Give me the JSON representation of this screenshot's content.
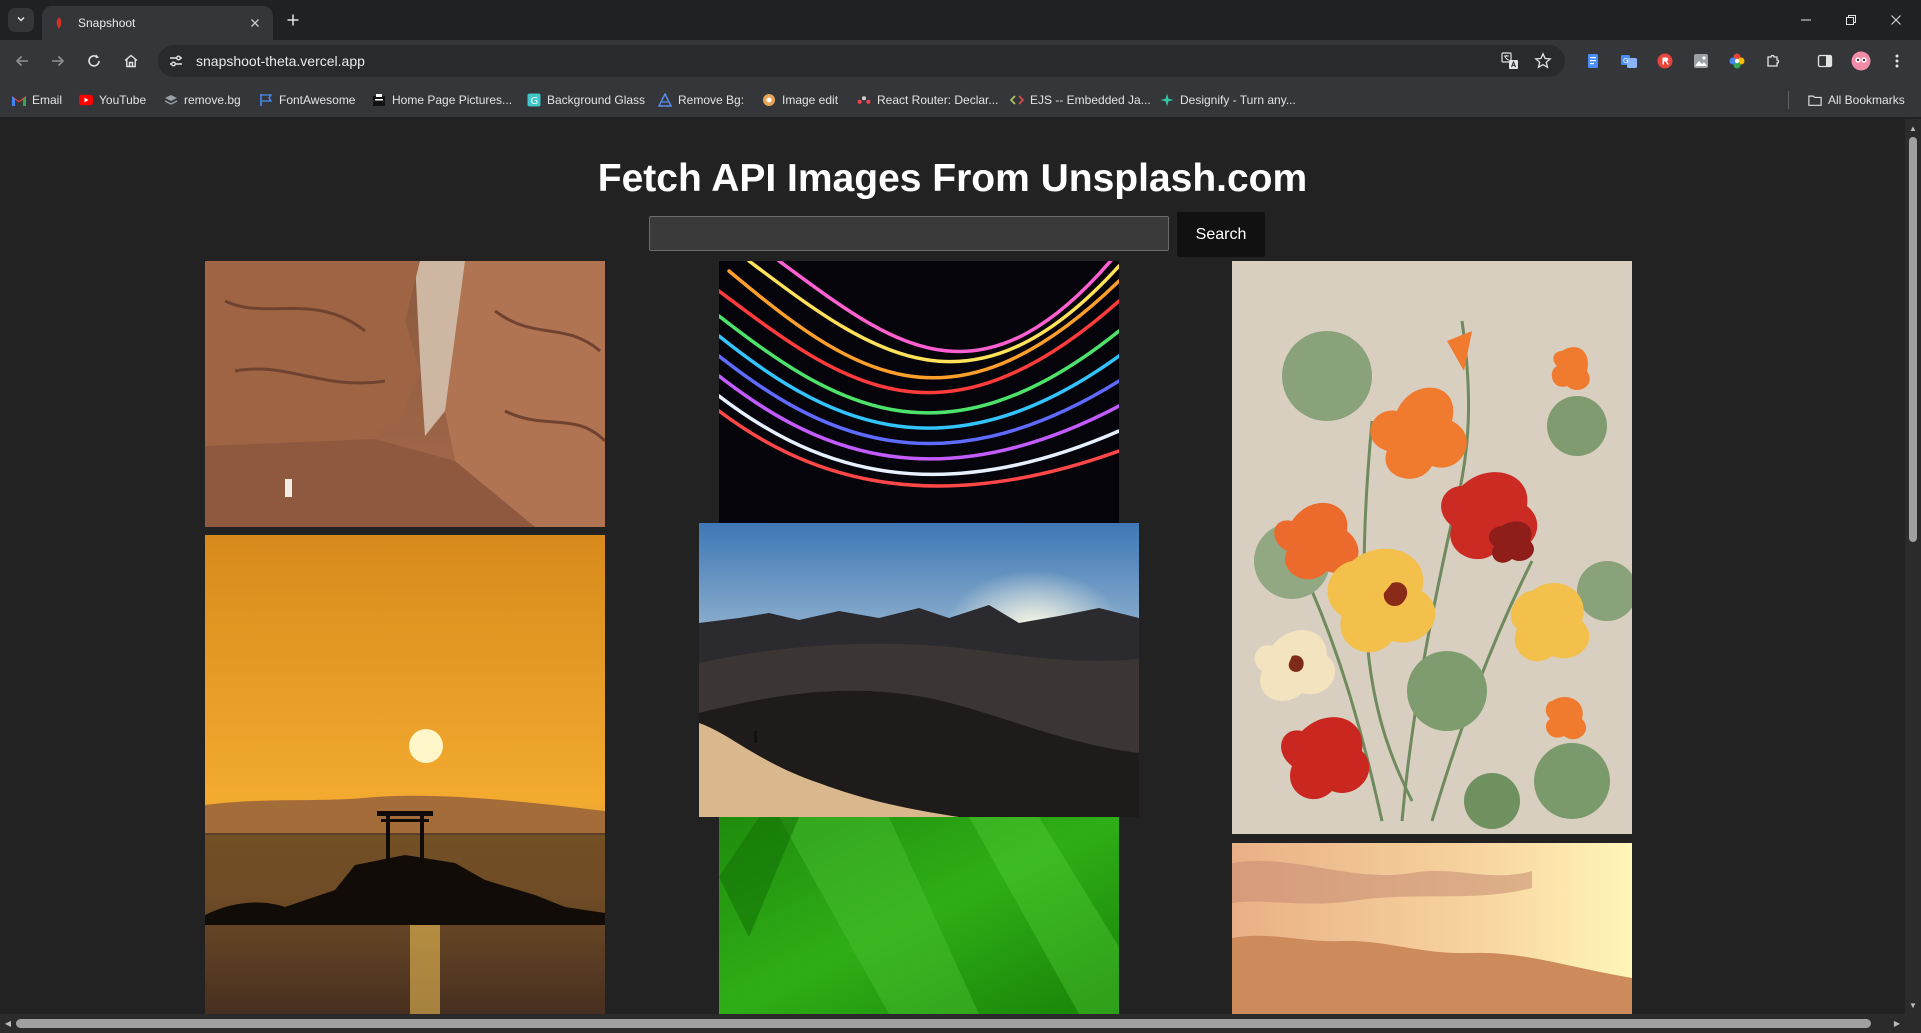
{
  "browser": {
    "tab": {
      "title": "Snapshoot"
    },
    "address": {
      "url": "snapshoot-theta.vercel.app"
    },
    "bookmarks": [
      {
        "label": "Email",
        "icon": "gmail-icon"
      },
      {
        "label": "YouTube",
        "icon": "youtube-icon"
      },
      {
        "label": "remove.bg",
        "icon": "removebg-icon"
      },
      {
        "label": "FontAwesome",
        "icon": "flag-icon"
      },
      {
        "label": "Home Page Pictures...",
        "icon": "bookmark-site-icon"
      },
      {
        "label": "Background Glass",
        "icon": "bookmark-site-icon"
      },
      {
        "label": "Remove Bg:",
        "icon": "bookmark-site-icon"
      },
      {
        "label": "Image edit",
        "icon": "bookmark-site-icon"
      },
      {
        "label": "React Router: Declar...",
        "icon": "react-router-icon"
      },
      {
        "label": "EJS -- Embedded Ja...",
        "icon": "ejs-icon"
      },
      {
        "label": "Designify - Turn any...",
        "icon": "designify-icon"
      }
    ],
    "all_bookmarks": "All Bookmarks"
  },
  "page": {
    "heading": "Fetch API Images From Unsplash.com",
    "search": {
      "value": "",
      "placeholder": ""
    },
    "search_button": "Search"
  },
  "colors": {
    "page_bg": "#222222",
    "chrome_bg": "#202124",
    "toolbar_bg": "#35363a"
  }
}
